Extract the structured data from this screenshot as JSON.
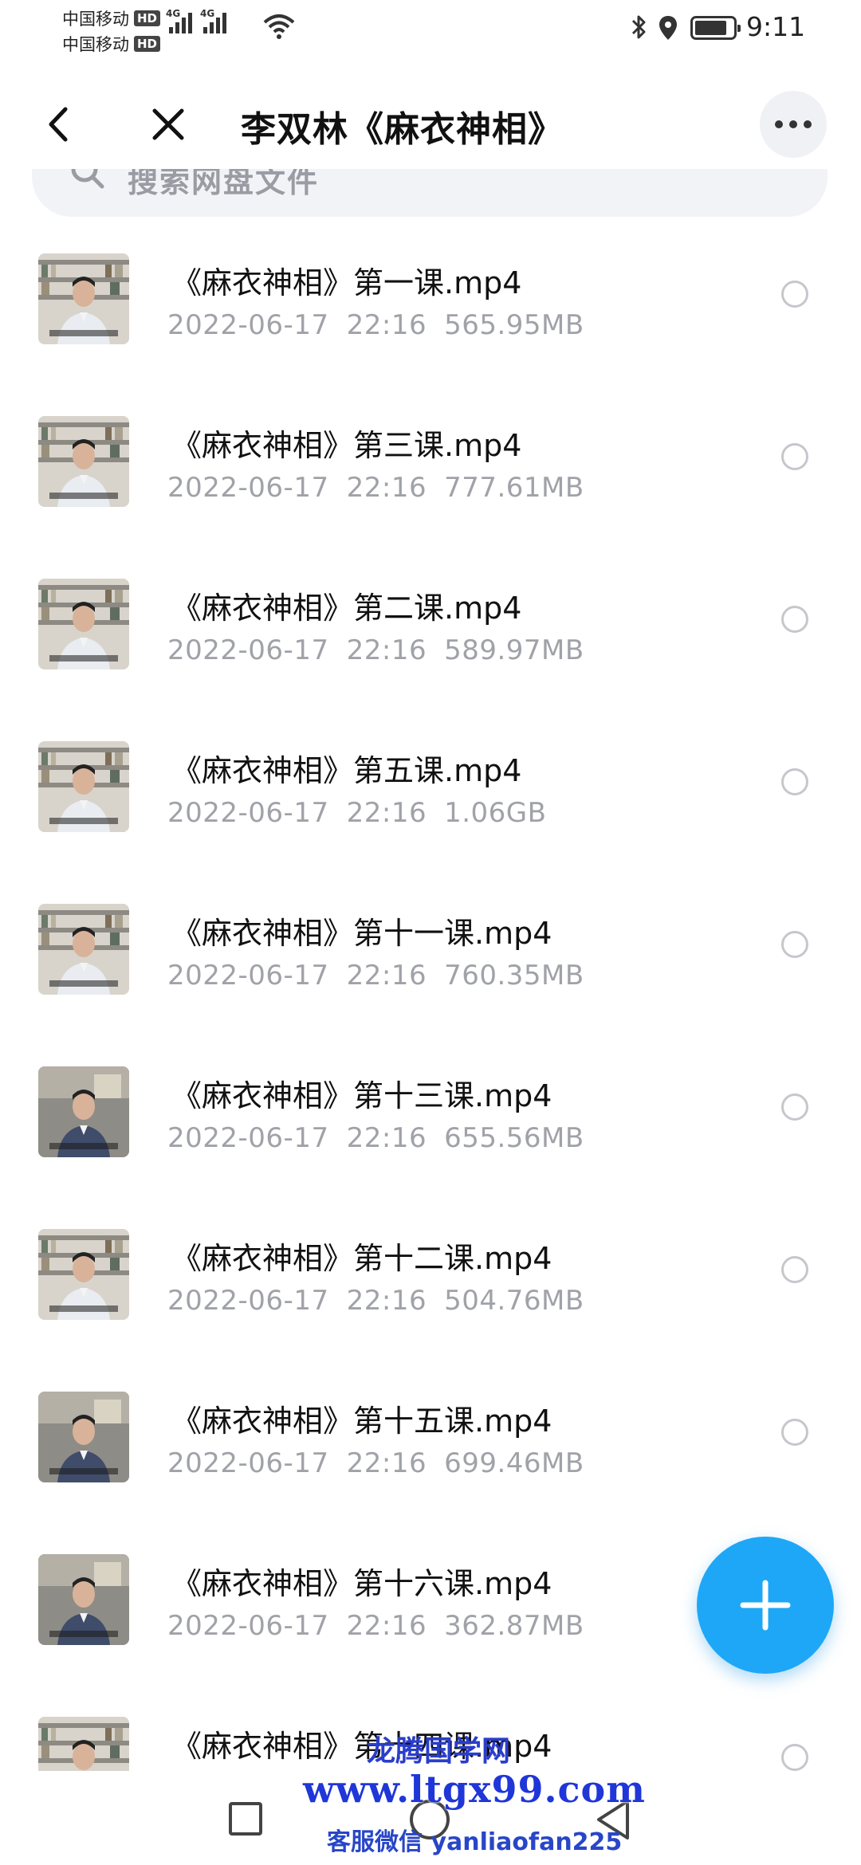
{
  "status_bar": {
    "carrier1": "中国移动",
    "carrier2": "中国移动",
    "hd_badge": "HD",
    "network": "4G",
    "time": "9:11"
  },
  "header": {
    "title": "李双林《麻衣神相》"
  },
  "search": {
    "placeholder": "搜索网盘文件"
  },
  "files": [
    {
      "name": "《麻衣神相》第一课.mp4",
      "date": "2022-06-17",
      "time": "22:16",
      "size": "565.95MB"
    },
    {
      "name": "《麻衣神相》第三课.mp4",
      "date": "2022-06-17",
      "time": "22:16",
      "size": "777.61MB"
    },
    {
      "name": "《麻衣神相》第二课.mp4",
      "date": "2022-06-17",
      "time": "22:16",
      "size": "589.97MB"
    },
    {
      "name": "《麻衣神相》第五课.mp4",
      "date": "2022-06-17",
      "time": "22:16",
      "size": "1.06GB"
    },
    {
      "name": "《麻衣神相》第十一课.mp4",
      "date": "2022-06-17",
      "time": "22:16",
      "size": "760.35MB"
    },
    {
      "name": "《麻衣神相》第十三课.mp4",
      "date": "2022-06-17",
      "time": "22:16",
      "size": "655.56MB"
    },
    {
      "name": "《麻衣神相》第十二课.mp4",
      "date": "2022-06-17",
      "time": "22:16",
      "size": "504.76MB"
    },
    {
      "name": "《麻衣神相》第十五课.mp4",
      "date": "2022-06-17",
      "time": "22:16",
      "size": "699.46MB"
    },
    {
      "name": "《麻衣神相》第十六课.mp4",
      "date": "2022-06-17",
      "time": "22:16",
      "size": "362.87MB"
    },
    {
      "name": "《麻衣神相》第十四课.mp4",
      "date": "",
      "time": "",
      "size": ""
    }
  ],
  "watermark": {
    "title": "龙腾国学网",
    "url": "www.ltgx99.com",
    "contact": "客服微信 yanliaofan225"
  },
  "colors": {
    "accent": "#1ea7f6",
    "meta_text": "#a0a2a8",
    "watermark": "#1f36d8"
  },
  "icons": {
    "back": "chevron-left-icon",
    "close": "close-icon",
    "more": "more-icon",
    "search": "search-icon",
    "fab": "plus-icon"
  }
}
